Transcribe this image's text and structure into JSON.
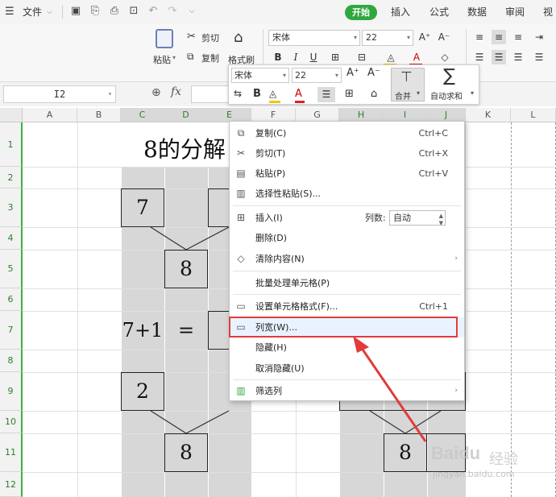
{
  "menubar": {
    "file_label": "文件",
    "start_tab": "开始",
    "tabs": [
      "插入",
      "公式",
      "数据",
      "审阅",
      "视图"
    ]
  },
  "ribbon": {
    "paste_label": "粘贴",
    "cut_label": "剪切",
    "copy_label": "复制",
    "format_painter_label": "格式刷",
    "font_name": "宋体",
    "font_size": "22"
  },
  "formula_bar": {
    "cell_ref": "I2",
    "fx_label": "fx"
  },
  "mini_toolbar": {
    "font_name": "宋体",
    "font_size": "22",
    "merge_label": "合并",
    "autosum_label": "自动求和"
  },
  "sheet": {
    "columns": [
      "A",
      "B",
      "C",
      "D",
      "E",
      "F",
      "G",
      "H",
      "I",
      "J",
      "K",
      "L"
    ],
    "rows": [
      "1",
      "2",
      "3",
      "4",
      "5",
      "6",
      "7",
      "8",
      "9",
      "10",
      "11",
      "12"
    ],
    "title_text": "8的分解",
    "cells": {
      "c3": "7",
      "d5": "8",
      "c7": "7+1",
      "d7": "=",
      "c9": "2",
      "d11": "8",
      "i11": "8"
    }
  },
  "context_menu": {
    "items": [
      {
        "label": "复制(C)",
        "shortcut": "Ctrl+C",
        "icon": "copy-icon"
      },
      {
        "label": "剪切(T)",
        "shortcut": "Ctrl+X",
        "icon": "scissors-icon"
      },
      {
        "label": "粘贴(P)",
        "shortcut": "Ctrl+V",
        "icon": "paste-icon"
      },
      {
        "label": "选择性粘贴(S)...",
        "shortcut": "",
        "icon": "paste-special-icon"
      },
      {
        "label": "插入(I)",
        "shortcut": "",
        "icon": "insert-icon"
      },
      {
        "label": "删除(D)",
        "shortcut": "",
        "icon": ""
      },
      {
        "label": "清除内容(N)",
        "shortcut": "",
        "icon": "eraser-icon"
      },
      {
        "label": "批量处理单元格(P)",
        "shortcut": "",
        "icon": ""
      },
      {
        "label": "设置单元格格式(F)...",
        "shortcut": "Ctrl+1",
        "icon": "format-cells-icon"
      },
      {
        "label": "列宽(W)...",
        "shortcut": "",
        "icon": "column-width-icon"
      },
      {
        "label": "隐藏(H)",
        "shortcut": "",
        "icon": ""
      },
      {
        "label": "取消隐藏(U)",
        "shortcut": "",
        "icon": ""
      },
      {
        "label": "筛选列",
        "shortcut": "",
        "icon": "filter-column-icon"
      }
    ],
    "insert_count_label": "列数:",
    "insert_count_value": "自动"
  },
  "watermark": {
    "brand": "Baidu",
    "brand_cn": "经验",
    "url": "jingyan.baidu.com"
  },
  "colors": {
    "accent_green": "#2fa83f",
    "highlight_red": "#e23b3b"
  }
}
